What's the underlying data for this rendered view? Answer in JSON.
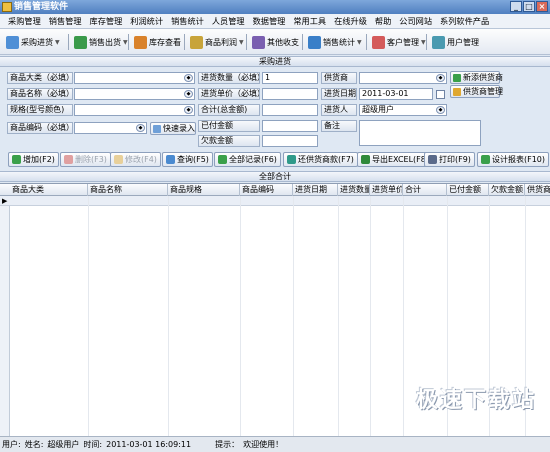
{
  "window": {
    "title": "销售管理软件"
  },
  "menu": [
    "采购管理",
    "销售管理",
    "库存管理",
    "利润统计",
    "销售统计",
    "人员管理",
    "数据管理",
    "常用工具",
    "在线升级",
    "帮助",
    "公司网站",
    "系列软件产品"
  ],
  "toolbar": {
    "purchase": "采购进货",
    "sales_out": "销售出货",
    "stock_view": "库存查看",
    "profit": "商品利润",
    "other": "其他收支",
    "sales_stat": "销售统计",
    "customer": "客户管理",
    "user": "用户管理"
  },
  "section_title": "采购进货",
  "form": {
    "category_label": "商品大类（必填）",
    "category_value": "",
    "name_label": "商品名称（必填）",
    "name_value": "",
    "spec_label": "规格(型号颜色)",
    "spec_value": "",
    "code_label": "商品编码（必填）",
    "code_value": "",
    "quick_entry": "快速录入",
    "qty_label": "进货数量（必填）",
    "qty_value": "1",
    "price_label": "进货单价（必填）",
    "price_value": "",
    "total_label": "合计(总金额)",
    "total_value": "",
    "paid_label": "已付金额",
    "paid_value": "",
    "owed_label": "欠款金额",
    "owed_value": "",
    "supplier_label": "供货商",
    "supplier_value": "",
    "date_label": "进货日期",
    "date_value": "2011-03-01",
    "person_label": "进货人",
    "person_value": "超级用户",
    "note_label": "备注",
    "note_value": "",
    "add_supplier": "新添供货商",
    "manage_supplier": "供货商管理"
  },
  "actions": {
    "add": "增加(F2)",
    "delete": "删除(F3)",
    "modify": "修改(F4)",
    "query": "查询(F5)",
    "all_records": "全部记录(F6)",
    "repay": "还供货商款(F7)",
    "export": "导出EXCEL(F8)",
    "print": "打印(F9)",
    "report": "设计报表(F10)"
  },
  "total_title": "全部合计",
  "grid": {
    "columns": [
      "商品大类",
      "商品名称",
      "商品规格",
      "商品编码",
      "进货日期",
      "进货数量",
      "进货单价",
      "合计",
      "已付金额",
      "欠款金额",
      "供货商"
    ]
  },
  "watermark": "极速下载站",
  "status": {
    "user_label": "用户:",
    "name_label": "姓名:",
    "name_value": "超级用户",
    "time_label": "时间:",
    "time_value": "2011-03-01 16:09:11",
    "tip_label": "提示：",
    "tip_value": "欢迎使用！"
  }
}
